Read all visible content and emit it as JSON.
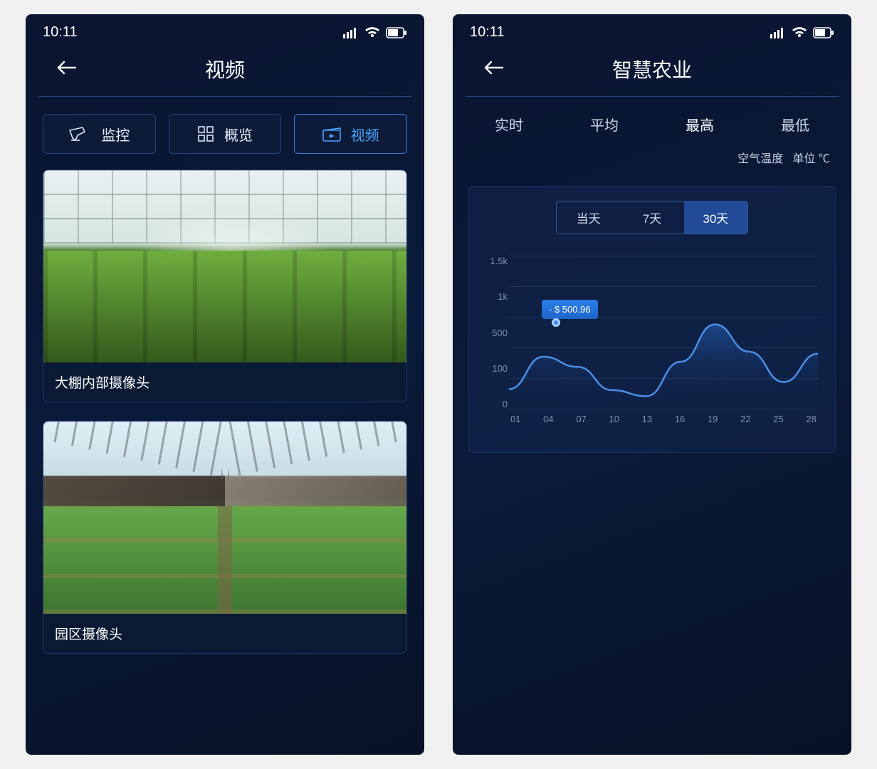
{
  "status": {
    "time": "10:11"
  },
  "left": {
    "title": "视频",
    "tabs": {
      "monitor": "监控",
      "overview": "概览",
      "video": "视频",
      "active": "video"
    },
    "cards": [
      {
        "label": "大棚内部摄像头"
      },
      {
        "label": "园区摄像头"
      }
    ]
  },
  "right": {
    "title": "智慧农业",
    "topTabs": {
      "items": [
        "实时",
        "平均",
        "最高",
        "最低"
      ],
      "activeIndex": 2
    },
    "metricLabel": "空气温度",
    "unitLabel": "单位 ℃",
    "range": {
      "items": [
        "当天",
        "7天",
        "30天"
      ],
      "activeIndex": 2
    },
    "tooltip": "- $ 500.96"
  },
  "chart_data": {
    "type": "line",
    "title": "",
    "xlabel": "",
    "ylabel": "",
    "ylim": [
      0,
      1500
    ],
    "y_ticks": [
      "1.5k",
      "1k",
      "500",
      "100",
      "0"
    ],
    "x_ticks": [
      "01",
      "04",
      "07",
      "10",
      "13",
      "16",
      "19",
      "22",
      "25",
      "28"
    ],
    "x": [
      1,
      4,
      7,
      10,
      13,
      16,
      19,
      22,
      25,
      28
    ],
    "values": [
      180,
      500,
      400,
      170,
      110,
      450,
      820,
      550,
      250,
      530
    ],
    "highlight": {
      "x": 4,
      "value": 500.96
    }
  }
}
